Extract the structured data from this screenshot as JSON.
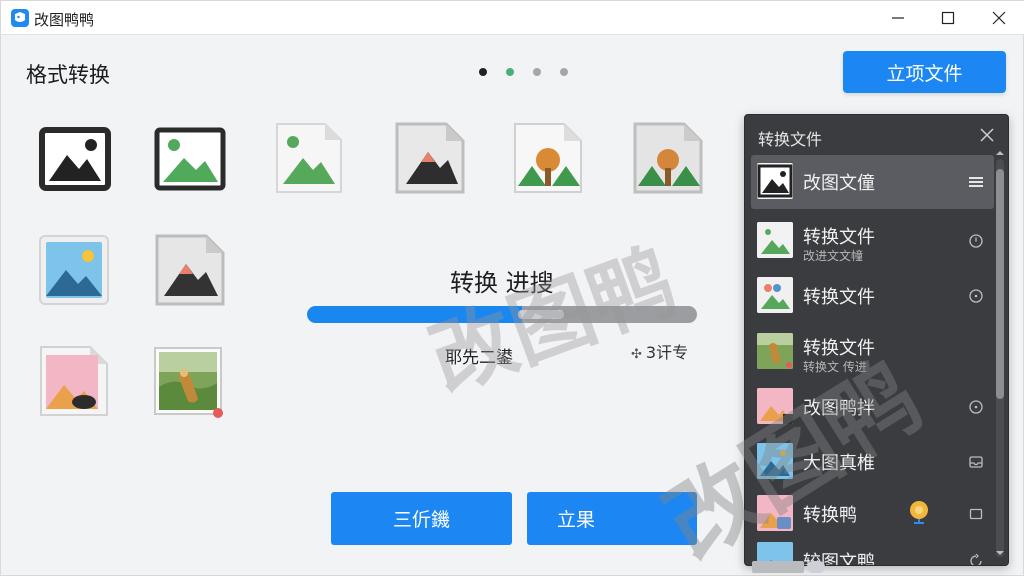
{
  "window": {
    "title": "改图鸭鸭"
  },
  "header": {
    "page_title": "格式转换",
    "new_button_label": "立项文件"
  },
  "pager": {
    "total": 4,
    "active_index": 0
  },
  "tiles": [
    {
      "icon": "image-frame-dark-icon"
    },
    {
      "icon": "image-frame-green-icon"
    },
    {
      "icon": "image-file-green-icon"
    },
    {
      "icon": "image-file-dark-icon"
    },
    {
      "icon": "image-file-tree-icon"
    },
    {
      "icon": "image-file-tree-gray-icon"
    },
    {
      "icon": "image-blue-landscape-icon"
    },
    {
      "icon": "image-file-gray-icon"
    },
    {
      "icon": "image-file-pink-icon"
    },
    {
      "icon": "photo-bird-icon"
    }
  ],
  "progress": {
    "title": "转换 进搜",
    "percent": 55,
    "left_text": "耶先二鍙",
    "right_prefix": "✣",
    "right_text": "3讦专"
  },
  "actions": {
    "left_label": "三伒鐖",
    "right_label": "立果"
  },
  "panel": {
    "title": "转换文件",
    "items": [
      {
        "name": "改图文僮",
        "sub": "",
        "icon": "menu-icon",
        "active": true
      },
      {
        "name": "转换文件",
        "sub": "改进文文幢",
        "icon": "clock-icon",
        "active": false
      },
      {
        "name": "转换文件",
        "sub": "",
        "icon": "circle-icon",
        "active": false
      },
      {
        "name": "转换文件",
        "sub": "转换文 传进",
        "icon": "none",
        "active": false
      },
      {
        "name": "改图鸭拌",
        "sub": "",
        "icon": "circle-icon",
        "active": false
      },
      {
        "name": "大图真椎",
        "sub": "",
        "icon": "inbox-icon",
        "active": false
      },
      {
        "name": "转换鸭",
        "sub": "",
        "icon": "square-icon",
        "active": false
      },
      {
        "name": "较图文鸭",
        "sub": "",
        "icon": "refresh-icon",
        "active": false
      }
    ]
  },
  "watermark": {
    "text": "改图鸭"
  },
  "colors": {
    "accent": "#1c87f2",
    "panel_bg": "#3a3c40",
    "progress_track": "#9b9da1"
  }
}
